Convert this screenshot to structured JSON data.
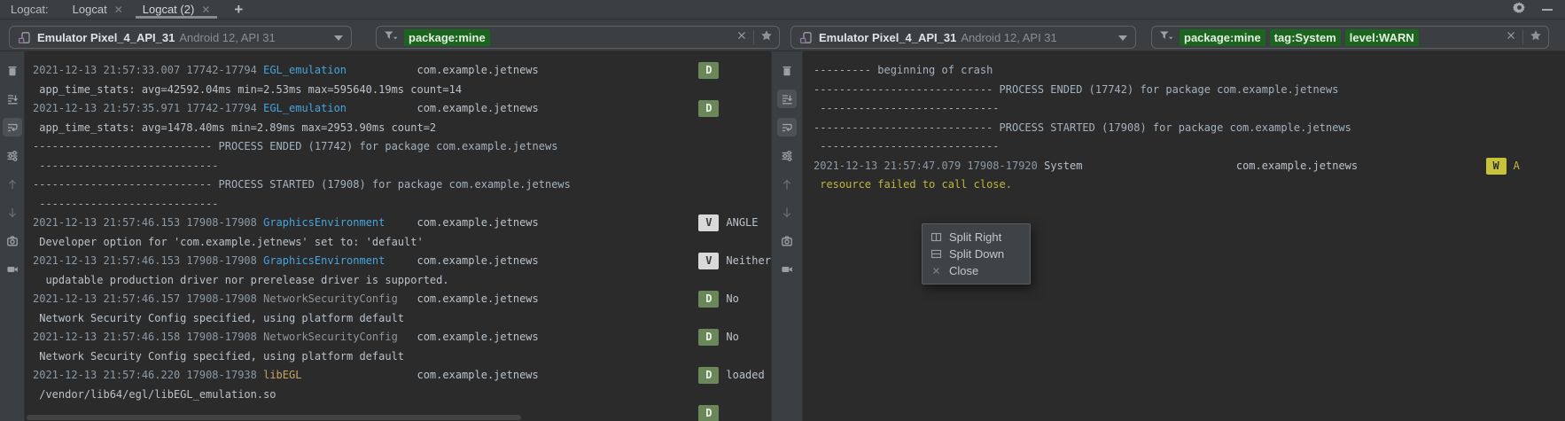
{
  "colors": {
    "chip-green": "#1c6420",
    "level-debug": "#6a8759",
    "level-verbose": "#d9d9d9",
    "level-warn": "#c8c23b",
    "warn-yellow": "#bfb63c",
    "tag-blue": "#46a4dd",
    "tag-tan": "#c8a661"
  },
  "header": {
    "label": "Logcat:",
    "tabs": [
      {
        "label": "Logcat",
        "close": "✕",
        "active": false
      },
      {
        "label": "Logcat (2)",
        "close": "✕",
        "active": true
      }
    ],
    "new_tab": "+"
  },
  "panes": [
    {
      "device": {
        "name": "Emulator Pixel_4_API_31",
        "details": "Android 12, API 31"
      },
      "filter": {
        "chips": [
          "package:mine"
        ]
      },
      "gutter": [
        {
          "icon": "trash"
        },
        {
          "icon": "scroll-to-end"
        },
        {
          "icon": "soft-wrap",
          "selected": true
        },
        {
          "icon": "logcat-settings"
        },
        {
          "icon": "arrow-up",
          "dim": true
        },
        {
          "icon": "arrow-down",
          "dim": true
        },
        {
          "icon": "camera"
        },
        {
          "icon": "video"
        }
      ],
      "log": [
        {
          "cells": [
            {
              "t": "2021-12-13 21:57:33.007 17742-17794 ",
              "c": "time"
            },
            {
              "t": "EGL_emulation           ",
              "c": "tag-blue"
            },
            {
              "t": "com.example.jetnews                         ",
              "c": "pkg"
            },
            {
              "b": "D",
              "c": "lvl-d"
            }
          ]
        },
        {
          "cells": [
            {
              "t": " app_time_stats: avg=42592.04ms min=2.53ms max=595640.19ms count=14",
              "c": "msg"
            }
          ]
        },
        {
          "cells": [
            {
              "t": "2021-12-13 21:57:35.971 17742-17794 ",
              "c": "time"
            },
            {
              "t": "EGL_emulation           ",
              "c": "tag-blue"
            },
            {
              "t": "com.example.jetnews                         ",
              "c": "pkg"
            },
            {
              "b": "D",
              "c": "lvl-d"
            }
          ]
        },
        {
          "cells": [
            {
              "t": " app_time_stats: avg=1478.40ms min=2.89ms max=2953.90ms count=2",
              "c": "msg"
            }
          ]
        },
        {
          "cells": [
            {
              "t": "---------------------------- PROCESS ENDED (17742) for package com.example.jetnews",
              "c": "proc"
            }
          ]
        },
        {
          "cells": [
            {
              "t": " ----------------------------",
              "c": "proc"
            }
          ]
        },
        {
          "cells": [
            {
              "t": "---------------------------- PROCESS STARTED (17908) for package com.example.jetnews",
              "c": "proc"
            }
          ]
        },
        {
          "cells": [
            {
              "t": " ----------------------------",
              "c": "proc"
            }
          ]
        },
        {
          "cells": [
            {
              "t": "2021-12-13 21:57:46.153 17908-17908 ",
              "c": "time"
            },
            {
              "t": "GraphicsEnvironment     ",
              "c": "tag-blue"
            },
            {
              "t": "com.example.jetnews                         ",
              "c": "pkg"
            },
            {
              "b": "V",
              "c": "lvl-v"
            },
            {
              "t": "ANGLE",
              "c": "msg"
            }
          ]
        },
        {
          "cells": [
            {
              "t": " Developer option for 'com.example.jetnews' set to: 'default'",
              "c": "msg"
            }
          ]
        },
        {
          "cells": [
            {
              "t": "2021-12-13 21:57:46.153 17908-17908 ",
              "c": "time"
            },
            {
              "t": "GraphicsEnvironment     ",
              "c": "tag-blue"
            },
            {
              "t": "com.example.jetnews                         ",
              "c": "pkg"
            },
            {
              "b": "V",
              "c": "lvl-v"
            },
            {
              "t": "Neither",
              "c": "msg"
            }
          ]
        },
        {
          "cells": [
            {
              "t": "  updatable production driver nor prerelease driver is supported.",
              "c": "msg"
            }
          ]
        },
        {
          "cells": [
            {
              "t": "2021-12-13 21:57:46.157 17908-17908 ",
              "c": "time"
            },
            {
              "t": "NetworkSecurityConfig   ",
              "c": "tag-gray"
            },
            {
              "t": "com.example.jetnews                         ",
              "c": "pkg"
            },
            {
              "b": "D",
              "c": "lvl-d"
            },
            {
              "t": "No",
              "c": "msg"
            }
          ]
        },
        {
          "cells": [
            {
              "t": " Network Security Config specified, using platform default",
              "c": "msg"
            }
          ]
        },
        {
          "cells": [
            {
              "t": "2021-12-13 21:57:46.158 17908-17908 ",
              "c": "time"
            },
            {
              "t": "NetworkSecurityConfig   ",
              "c": "tag-gray"
            },
            {
              "t": "com.example.jetnews                         ",
              "c": "pkg"
            },
            {
              "b": "D",
              "c": "lvl-d"
            },
            {
              "t": "No",
              "c": "msg"
            }
          ]
        },
        {
          "cells": [
            {
              "t": " Network Security Config specified, using platform default",
              "c": "msg"
            }
          ]
        },
        {
          "cells": [
            {
              "t": "2021-12-13 21:57:46.220 17908-17938 ",
              "c": "time"
            },
            {
              "t": "libEGL                  ",
              "c": "tag-tan"
            },
            {
              "t": "com.example.jetnews                         ",
              "c": "pkg"
            },
            {
              "b": "D",
              "c": "lvl-d"
            },
            {
              "t": "loaded",
              "c": "msg"
            }
          ]
        },
        {
          "cells": [
            {
              "t": " /vendor/lib64/egl/libEGL_emulation.so",
              "c": "msg"
            }
          ]
        },
        {
          "cells": [
            {
              "t": "                                                                                                        ",
              "c": "time"
            },
            {
              "b": "D",
              "c": "lvl-d"
            }
          ]
        }
      ]
    },
    {
      "device": {
        "name": "Emulator Pixel_4_API_31",
        "details": "Android 12, API 31"
      },
      "filter": {
        "chips": [
          "package:mine",
          "tag:System",
          "level:WARN"
        ]
      },
      "gutter": [
        {
          "icon": "trash"
        },
        {
          "icon": "scroll-to-end",
          "selected": true
        },
        {
          "icon": "soft-wrap",
          "selected": true
        },
        {
          "icon": "logcat-settings"
        },
        {
          "icon": "arrow-up",
          "dim": true
        },
        {
          "icon": "arrow-down",
          "dim": true
        },
        {
          "icon": "camera"
        },
        {
          "icon": "video"
        }
      ],
      "log": [
        {
          "cells": [
            {
              "t": "--------- beginning of crash",
              "c": "proc"
            }
          ]
        },
        {
          "cells": [
            {
              "t": "---------------------------- PROCESS ENDED (17742) for package com.example.jetnews",
              "c": "proc"
            }
          ]
        },
        {
          "cells": [
            {
              "t": " ----------------------------",
              "c": "proc"
            }
          ]
        },
        {
          "cells": [
            {
              "t": "---------------------------- PROCESS STARTED (17908) for package com.example.jetnews",
              "c": "proc"
            }
          ]
        },
        {
          "cells": [
            {
              "t": " ----------------------------",
              "c": "proc"
            }
          ]
        },
        {
          "cells": [
            {
              "t": "2021-12-13 21:57:47.079 17908-17920 ",
              "c": "time"
            },
            {
              "t": "System                        ",
              "c": "tag-gray2"
            },
            {
              "t": "com.example.jetnews                    ",
              "c": "pkg"
            },
            {
              "b": "W",
              "c": "lvl-w"
            },
            {
              "t": "A",
              "c": "warn"
            }
          ]
        },
        {
          "cells": [
            {
              "t": " resource failed to call close.",
              "c": "warn"
            }
          ]
        }
      ]
    }
  ],
  "context_menu": {
    "items": [
      {
        "icon": "split-right",
        "label": "Split Right"
      },
      {
        "icon": "split-down",
        "label": "Split Down"
      },
      {
        "icon": "close-x",
        "label": "Close",
        "dim": true
      }
    ]
  }
}
